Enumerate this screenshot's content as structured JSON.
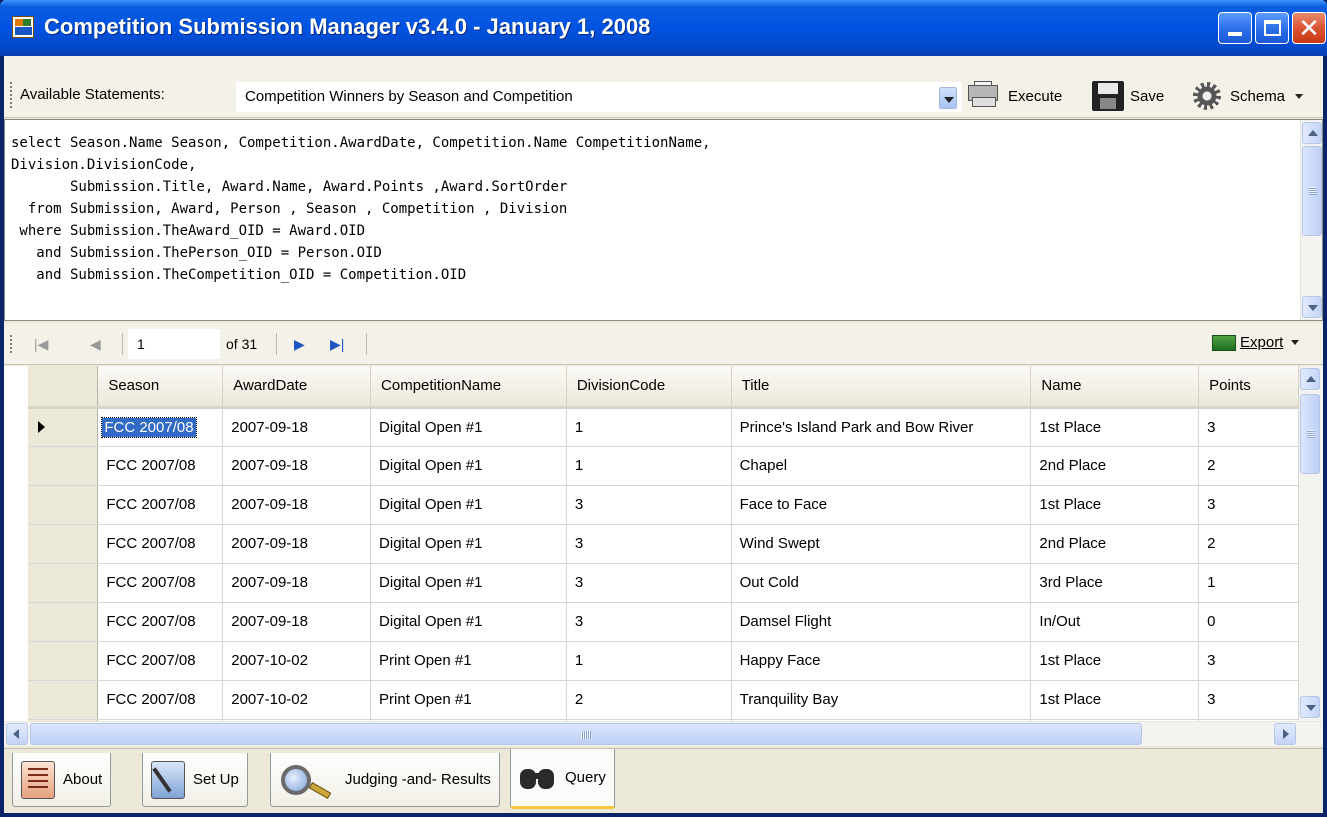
{
  "window": {
    "title": "Competition Submission Manager v3.4.0 - January 1, 2008",
    "close_glyph": "✕"
  },
  "toolbar": {
    "available_label": "Available Statements:",
    "statement_selected": "Competition Winners by Season and Competition",
    "execute_label": "Execute",
    "save_label": "Save",
    "schema_label": "Schema"
  },
  "sql": {
    "text": "select Season.Name Season, Competition.AwardDate, Competition.Name CompetitionName,\nDivision.DivisionCode,\n       Submission.Title, Award.Name, Award.Points ,Award.SortOrder\n  from Submission, Award, Person , Season , Competition , Division\n where Submission.TheAward_OID = Award.OID\n   and Submission.ThePerson_OID = Person.OID\n   and Submission.TheCompetition_OID = Competition.OID"
  },
  "navigator": {
    "position": "1",
    "of_label": "of 31",
    "first_glyph": "|◀",
    "prev_glyph": "◀",
    "next_glyph": "▶",
    "last_glyph": "▶|",
    "export_label": "Export"
  },
  "grid": {
    "columns": [
      "Season",
      "AwardDate",
      "CompetitionName",
      "DivisionCode",
      "Title",
      "Name",
      "Points"
    ],
    "rows": [
      [
        "FCC 2007/08",
        "2007-09-18",
        "Digital Open #1",
        "1",
        "Prince's Island Park and Bow River",
        "1st Place",
        "3"
      ],
      [
        "FCC 2007/08",
        "2007-09-18",
        "Digital Open #1",
        "1",
        "Chapel",
        "2nd Place",
        "2"
      ],
      [
        "FCC 2007/08",
        "2007-09-18",
        "Digital Open #1",
        "3",
        "Face to Face",
        "1st Place",
        "3"
      ],
      [
        "FCC 2007/08",
        "2007-09-18",
        "Digital Open #1",
        "3",
        "Wind Swept",
        "2nd Place",
        "2"
      ],
      [
        "FCC 2007/08",
        "2007-09-18",
        "Digital Open #1",
        "3",
        "Out Cold",
        "3rd Place",
        "1"
      ],
      [
        "FCC 2007/08",
        "2007-09-18",
        "Digital Open #1",
        "3",
        "Damsel Flight",
        "In/Out",
        "0"
      ],
      [
        "FCC 2007/08",
        "2007-10-02",
        "Print Open #1",
        "1",
        "Happy Face",
        "1st Place",
        "3"
      ],
      [
        "FCC 2007/08",
        "2007-10-02",
        "Print Open #1",
        "2",
        "Tranquility Bay",
        "1st Place",
        "3"
      ]
    ]
  },
  "tabs": [
    {
      "label": "About",
      "icon": "about-icon"
    },
    {
      "label": "Set Up",
      "icon": "setup-icon"
    },
    {
      "label": "Judging -and- Results",
      "icon": "magnifier-icon"
    },
    {
      "label": "Query",
      "icon": "binoculars-icon",
      "active": true
    }
  ]
}
